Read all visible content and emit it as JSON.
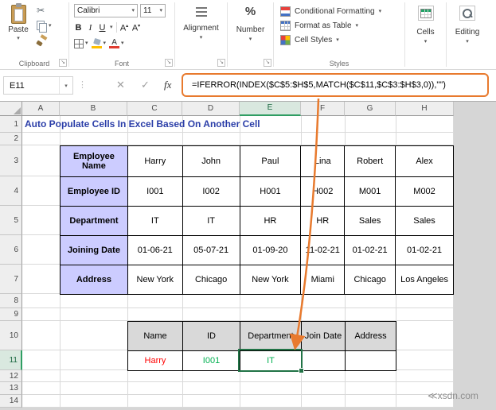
{
  "watermark": "≪xsdn.com",
  "icons": {
    "caret": "▾",
    "caret_up": "▴",
    "cut_scissors": "✂",
    "grip_dots": "⋮",
    "cancel_x": "✕",
    "enter_check": "✓",
    "dialog_launcher": "↘"
  },
  "ribbon": {
    "paste_label": "Paste",
    "font_name": "Calibri",
    "font_size": "11",
    "bold": "B",
    "italic": "I",
    "underline": "U",
    "grow_letter": "A",
    "shrink_letter": "A",
    "font_color_letter": "A",
    "percent": "%",
    "alignment_label": "Alignment",
    "number_label": "Number",
    "conditional_formatting_label": "Conditional Formatting",
    "format_as_table_label": "Format as Table",
    "cell_styles_label": "Cell Styles",
    "cells_label": "Cells",
    "editing_label": "Editing",
    "group_labels": {
      "clipboard": "Clipboard",
      "font": "Font",
      "styles": "Styles"
    }
  },
  "formula_bar": {
    "name_box_value": "E11",
    "fx_label": "fx",
    "formula": "=IFERROR(INDEX($C$5:$H$5,MATCH($C$11,$C$3:$H$3,0)),\"\")"
  },
  "sheet": {
    "title": "Auto Populate Cells In Excel Based On Another Cell",
    "columns": [
      "A",
      "B",
      "C",
      "D",
      "E",
      "F",
      "G",
      "H"
    ],
    "rows": [
      "1",
      "2",
      "3",
      "4",
      "5",
      "6",
      "7",
      "8",
      "9",
      "10",
      "11",
      "12",
      "13",
      "14"
    ],
    "selected_cell": "E11"
  },
  "table1": {
    "rows": [
      {
        "label": "Employee Name",
        "values": [
          "Harry",
          "John",
          "Paul",
          "Lina",
          "Robert",
          "Alex"
        ]
      },
      {
        "label": "Employee ID",
        "values": [
          "I001",
          "I002",
          "H001",
          "H002",
          "M001",
          "M002"
        ]
      },
      {
        "label": "Department",
        "values": [
          "IT",
          "IT",
          "HR",
          "HR",
          "Sales",
          "Sales"
        ]
      },
      {
        "label": "Joining Date",
        "values": [
          "01-06-21",
          "05-07-21",
          "01-09-20",
          "11-02-21",
          "01-02-21",
          "01-02-21"
        ]
      },
      {
        "label": "Address",
        "values": [
          "New York",
          "Chicago",
          "New York",
          "Miami",
          "Chicago",
          "Los Angeles"
        ]
      }
    ]
  },
  "table2": {
    "headers": [
      "Name",
      "ID",
      "Department",
      "Join Date",
      "Address"
    ],
    "values": [
      "Harry",
      "I001",
      "IT",
      "",
      ""
    ]
  },
  "colors": {
    "annotation_orange": "#E87A2E",
    "excel_green": "#217346",
    "result_green": "#00B050",
    "name_red": "#FF0000",
    "label_fill": "#CCCCFF",
    "lookup_header_fill": "#D9D9D9",
    "title_blue": "#2B3EA8"
  }
}
